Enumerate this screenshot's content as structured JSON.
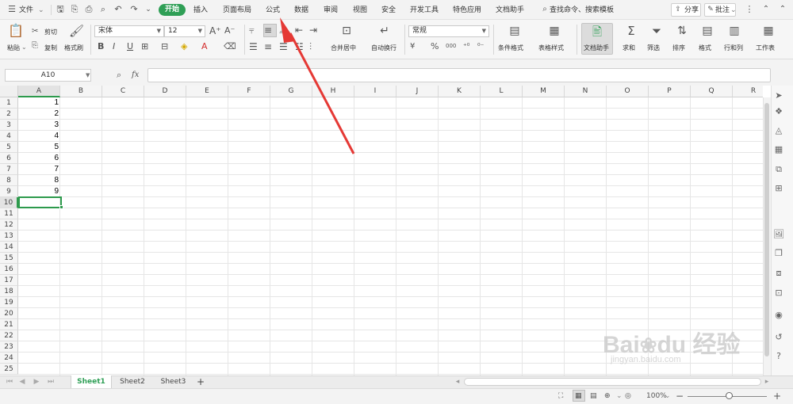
{
  "menubar": {
    "file": "文件",
    "tabs": [
      "开始",
      "插入",
      "页面布局",
      "公式",
      "数据",
      "审阅",
      "视图",
      "安全",
      "开发工具",
      "特色应用",
      "文档助手"
    ],
    "search": "查找命令、搜索模板",
    "share": "分享",
    "comment": "批注"
  },
  "ribbon": {
    "paste": "粘贴",
    "cut": "剪切",
    "copy": "复制",
    "format_painter": "格式刷",
    "font_name": "宋体",
    "font_size": "12",
    "bold": "B",
    "italic": "I",
    "underline": "U",
    "merge_center": "合并居中",
    "wrap_text": "自动换行",
    "number_format": "常规",
    "percent": "%",
    "thousands": "000",
    "conditional_format": "条件格式",
    "table_style": "表格样式",
    "doc_helper": "文档助手",
    "sum": "求和",
    "filter": "筛选",
    "sort": "排序",
    "format": "格式",
    "row_col": "行和列",
    "worksheet": "工作表"
  },
  "formula": {
    "name_box": "A10",
    "fx": "fx",
    "value": ""
  },
  "grid": {
    "columns": [
      "A",
      "B",
      "C",
      "D",
      "E",
      "F",
      "G",
      "H",
      "I",
      "J",
      "K",
      "L",
      "M",
      "N",
      "O",
      "P",
      "Q",
      "R"
    ],
    "rows": [
      "1",
      "2",
      "3",
      "4",
      "5",
      "6",
      "7",
      "8",
      "9",
      "10",
      "11",
      "12",
      "13",
      "14",
      "15",
      "16",
      "17",
      "18",
      "19",
      "20",
      "21",
      "22",
      "23",
      "24",
      "25"
    ],
    "column_a_values": [
      "1",
      "2",
      "3",
      "4",
      "5",
      "6",
      "7",
      "8",
      "9"
    ],
    "selected_cell": "A10",
    "accent": "#2d9a4c"
  },
  "sheets": {
    "tabs": [
      "Sheet1",
      "Sheet2",
      "Sheet3"
    ],
    "active": "Sheet1",
    "add": "+"
  },
  "status": {
    "zoom": "100%"
  },
  "colors": {
    "start_tab": "#2f9f56",
    "arrow": "#e53935"
  }
}
